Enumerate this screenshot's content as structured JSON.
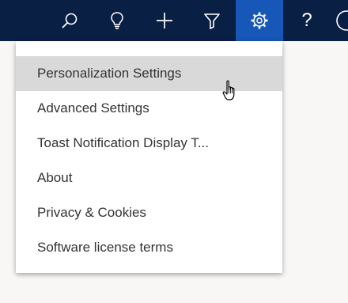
{
  "topbar": {
    "background": "#0a1f44",
    "active_color": "#1757b8",
    "buttons": [
      {
        "name": "search",
        "icon": "search-icon"
      },
      {
        "name": "ideas",
        "icon": "lightbulb-icon"
      },
      {
        "name": "new",
        "icon": "plus-icon"
      },
      {
        "name": "filter",
        "icon": "filter-icon"
      },
      {
        "name": "settings",
        "icon": "gear-icon",
        "active": true
      },
      {
        "name": "help",
        "icon": "help-icon",
        "label": "?"
      },
      {
        "name": "user",
        "icon": "avatar-icon"
      }
    ]
  },
  "menu": {
    "items": [
      {
        "label": "Personalization Settings",
        "hovered": true
      },
      {
        "label": "Advanced Settings"
      },
      {
        "label": "Toast Notification Display T..."
      },
      {
        "label": "About"
      },
      {
        "label": "Privacy & Cookies"
      },
      {
        "label": "Software license terms"
      }
    ]
  },
  "cursor": {
    "icon": "hand-pointer-icon"
  }
}
